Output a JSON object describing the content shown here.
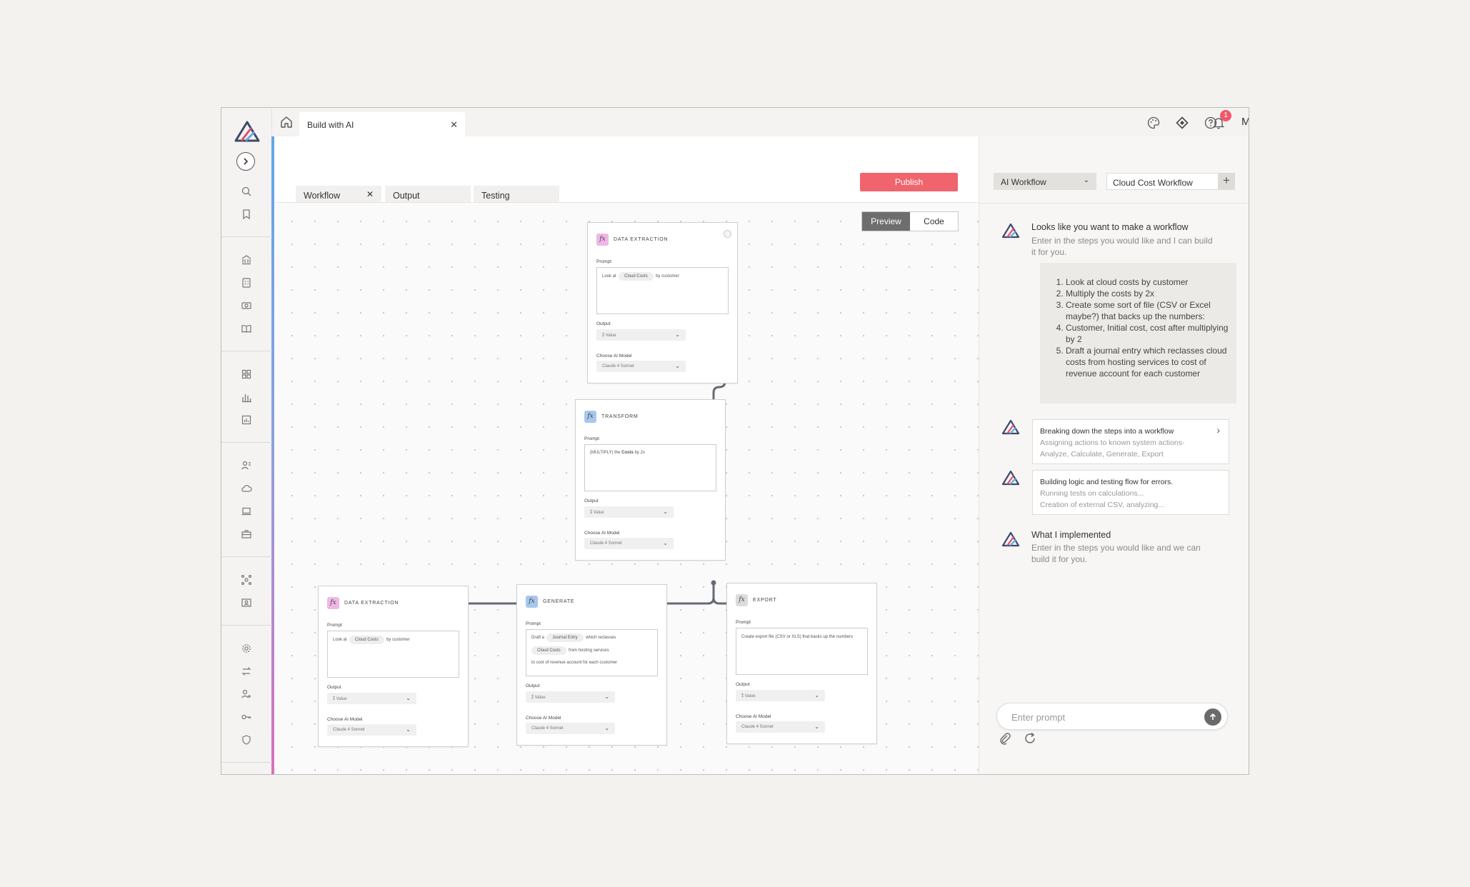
{
  "colors": {
    "accent_red": "#f0646d",
    "sidebar_accent_top": "#5fa8e8",
    "sidebar_accent_bottom": "#d96fbd"
  },
  "topbar": {
    "page_tab": "Build with AI",
    "notifications_count": "1",
    "user_name": "Marley",
    "icons": [
      "palette-icon",
      "diamond-icon",
      "help-icon",
      "bell-icon"
    ]
  },
  "main": {
    "tabs": [
      {
        "label": "Workflow"
      },
      {
        "label": "Output"
      },
      {
        "label": "Testing"
      }
    ],
    "publish_label": "Publish",
    "view_toggle": {
      "preview": "Preview",
      "code": "Code"
    }
  },
  "nodes": {
    "n1": {
      "title": "DATA EXTRACTION",
      "prompt_label": "Prompt",
      "prompt_pre": "Look at",
      "chip": "Cloud Costs",
      "prompt_post": "by customer",
      "output_label": "Output",
      "output_value": "Value",
      "model_label": "Choose AI Model",
      "model_value": "Claude 4 Sonnet"
    },
    "n2": {
      "title": "TRANSFORM",
      "prompt_label": "Prompt",
      "prompt_pre": "(MULTIPLY) the",
      "prompt_bold": "Costs",
      "prompt_post": "by 2x",
      "output_label": "Output",
      "output_value": "Value",
      "model_label": "Choose AI Model",
      "model_value": "Claude 4 Sonnet"
    },
    "n3": {
      "title": "DATA EXTRACTION",
      "prompt_label": "Prompt",
      "prompt_pre": "Look at",
      "chip": "Cloud Costs",
      "prompt_post": "by customer",
      "output_label": "Output",
      "output_value": "Value",
      "model_label": "Choose AI Model",
      "model_value": "Claude 4 Sonnet"
    },
    "n4": {
      "title": "GENERATE",
      "prompt_label": "Prompt",
      "prompt_pre": "Draft a",
      "chip1": "Journal Entry",
      "prompt_mid": "which reclasses",
      "chip2": "Cloud Costs",
      "prompt_mid2": "from hosting services",
      "prompt_post": "to cost of revenue account for each customer",
      "output_label": "Output",
      "output_value": "Value",
      "model_label": "Choose AI Model",
      "model_value": "Claude 4 Sonnet"
    },
    "n5": {
      "title": "EXPORT",
      "prompt_label": "Prompt",
      "prompt_text": "Create export file (CSV or XLS) that backs up the numbers",
      "output_label": "Output",
      "output_value": "Value",
      "model_label": "Choose AI Model",
      "model_value": "Claude 4 Sonnet"
    }
  },
  "rpanel": {
    "mode_select": "AI Workflow",
    "workflow_name": "Cloud Cost Workflow",
    "msg1": {
      "title": "Looks like you want to make a workflow",
      "sub": "Enter in the steps you would like and I can build it for you."
    },
    "steps": [
      "Look at cloud costs by customer",
      "Multiply the costs by 2x",
      "Create some sort of file (CSV or Excel maybe?) that backs up the numbers:",
      "Customer, Initial cost, cost after multiplying by 2",
      "Draft a journal entry which reclasses cloud costs from hosting services to cost of revenue account for each customer"
    ],
    "status1": {
      "title": "Breaking down the steps into a workflow",
      "line1": "Assigning actions to known system actions-",
      "line2": "Analyze, Calculate, Generate, Export"
    },
    "status2": {
      "title": "Building logic and testing flow for errors.",
      "line1": "Running tests on calculations...",
      "line2": "Creation of external CSV, analyzing..."
    },
    "msg2": {
      "title": "What I implemented",
      "sub": "Enter in the steps you would like and we can build it for you."
    },
    "prompt_placeholder": "Enter prompt"
  }
}
